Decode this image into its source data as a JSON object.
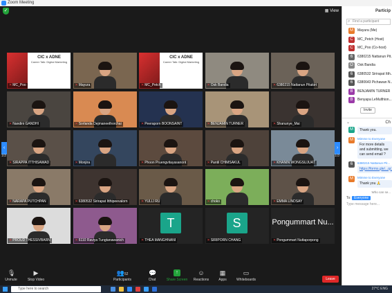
{
  "window": {
    "title": "Zoom Meeting"
  },
  "topbar": {
    "view_label": "View"
  },
  "tiles": [
    {
      "name": "MC_Poo",
      "kind": "slide",
      "slide_title": "CIC x ADNE",
      "slide_sub": "Career Talk: Digital Marketing"
    },
    {
      "name": "Mayura",
      "kind": "video",
      "bg": "#7a6650"
    },
    {
      "name": "MC_Petch",
      "kind": "slide",
      "slide_title": "CIC x ADNE",
      "slide_sub": "Career Talk: Digital Marketing"
    },
    {
      "name": "Osk Bandia",
      "kind": "video",
      "bg": "#8f8a80"
    },
    {
      "name": "6380215 Nattanun Pitakirt",
      "kind": "video",
      "bg": "#6b6258"
    },
    {
      "name": "Nandini GANDHI",
      "kind": "video",
      "bg": "#4a4540"
    },
    {
      "name": "Sorlanda Dejmaneethorchai",
      "kind": "video",
      "bg": "#d98a52"
    },
    {
      "name": "Peeraporn BOONSAINT",
      "kind": "video",
      "bg": "#243250"
    },
    {
      "name": "BENJAMIN TURNER",
      "kind": "video",
      "bg": "#a89478"
    },
    {
      "name": "Shanunye_Mai",
      "kind": "video",
      "bg": "#3a3330"
    },
    {
      "name": "SIRAPPA ITTHISAWAD",
      "kind": "video",
      "bg": "#5a5048"
    },
    {
      "name": "Monjira",
      "kind": "video",
      "bg": "#34465e"
    },
    {
      "name": "Phoon Pruengvitayasanont",
      "kind": "video",
      "bg": "#5c4a3e"
    },
    {
      "name": "Pantil CHIMSAKUL",
      "kind": "video",
      "bg": "#4e423a"
    },
    {
      "name": "KHANIN WONGSUJUAT",
      "kind": "video",
      "bg": "#7a8a98"
    },
    {
      "name": "NARAPA PUTCHPAN",
      "kind": "video",
      "bg": "#8a7a68"
    },
    {
      "name": "6380532 Sirirapat Itthipeevalorn",
      "kind": "video",
      "bg": "#3e3430"
    },
    {
      "name": "YULIJ RU",
      "kind": "video",
      "bg": "#6a5a48"
    },
    {
      "name": "choko",
      "kind": "video",
      "bg": "#7cae5a"
    },
    {
      "name": "EMMA LINDSAY",
      "kind": "video",
      "bg": "#5e5248"
    },
    {
      "name": "PROUD THESSIVBARN",
      "kind": "video",
      "bg": "#dcdcdc"
    },
    {
      "name": "6110 Raviya Tungtanawanich",
      "kind": "video",
      "bg": "#8e5a8e"
    },
    {
      "name": "THEA MANGHNANI",
      "kind": "avatar",
      "letter": "T",
      "color": "#1aa58a"
    },
    {
      "name": "SIRIPORN CHANG",
      "kind": "avatar",
      "letter": "S",
      "color": "#1aa58a"
    },
    {
      "name": "Pongummart Nuttaporpong",
      "kind": "name",
      "display": "Pongummart  Nu..."
    }
  ],
  "pager": {
    "left_label": "1/3",
    "right_label": "1/3"
  },
  "toolbar": {
    "unmute": "Unmute",
    "stop_video": "Stop Video",
    "participants": "Participants",
    "participants_count": "52",
    "chat": "Chat",
    "share": "Share Screen",
    "reactions": "Reactions",
    "apps": "Apps",
    "whiteboards": "Whiteboards",
    "leave": "Leave",
    "accent_green": "#23a33a",
    "leave_red": "#e02828"
  },
  "taskbar": {
    "search_placeholder": "Type here to search",
    "temp": "27°C",
    "lang": "ENG"
  },
  "side": {
    "title": "Particip",
    "search_placeholder": "Find a participant",
    "participants": [
      {
        "letter": "M",
        "name": "Mayura (Me)",
        "color": "#e87a2a"
      },
      {
        "letter": "C",
        "name": "MC_Petch (Host)",
        "color": "#c03030"
      },
      {
        "letter": "C",
        "name": "MC_Poo (Co-host)",
        "color": "#c03030"
      },
      {
        "letter": "6",
        "name": "6380215 Nattanun Pit...",
        "color": "#666"
      },
      {
        "letter": "O",
        "name": "Osk Bandia",
        "color": "#888"
      },
      {
        "letter": "6",
        "name": "6380532 Sirirapat Itth...",
        "color": "#555"
      },
      {
        "letter": "6",
        "name": "6380643 Pichawan N...",
        "color": "#555"
      },
      {
        "letter": "B",
        "name": "BENJAMIN TURNER",
        "color": "#9b3aa8"
      },
      {
        "letter": "B",
        "name": "Benyapa LeMulthion...",
        "color": "#9b3aa8"
      }
    ],
    "invite_label": "Invite",
    "chat_title": "Ch",
    "messages": [
      {
        "letter": "M",
        "color": "#1aa58a",
        "meta": "",
        "text": "Thank you."
      },
      {
        "letter": "M",
        "color": "#e87a2a",
        "meta": "Mimme to Everyone",
        "text": "For more details and submitting, we can send email ?"
      },
      {
        "letter": "6",
        "color": "#555",
        "meta": "6380215 Nattanun Pit...",
        "text": "https://forms.gle/...qc7",
        "link": true
      },
      {
        "letter": "M",
        "color": "#e87a2a",
        "meta": "Mimme to Everyone",
        "text": "Thank you 🙏"
      }
    ],
    "who_can_see": "Who can se...",
    "to_label": "To:",
    "to_target": "Everyone",
    "input_placeholder": "Type message here..."
  }
}
